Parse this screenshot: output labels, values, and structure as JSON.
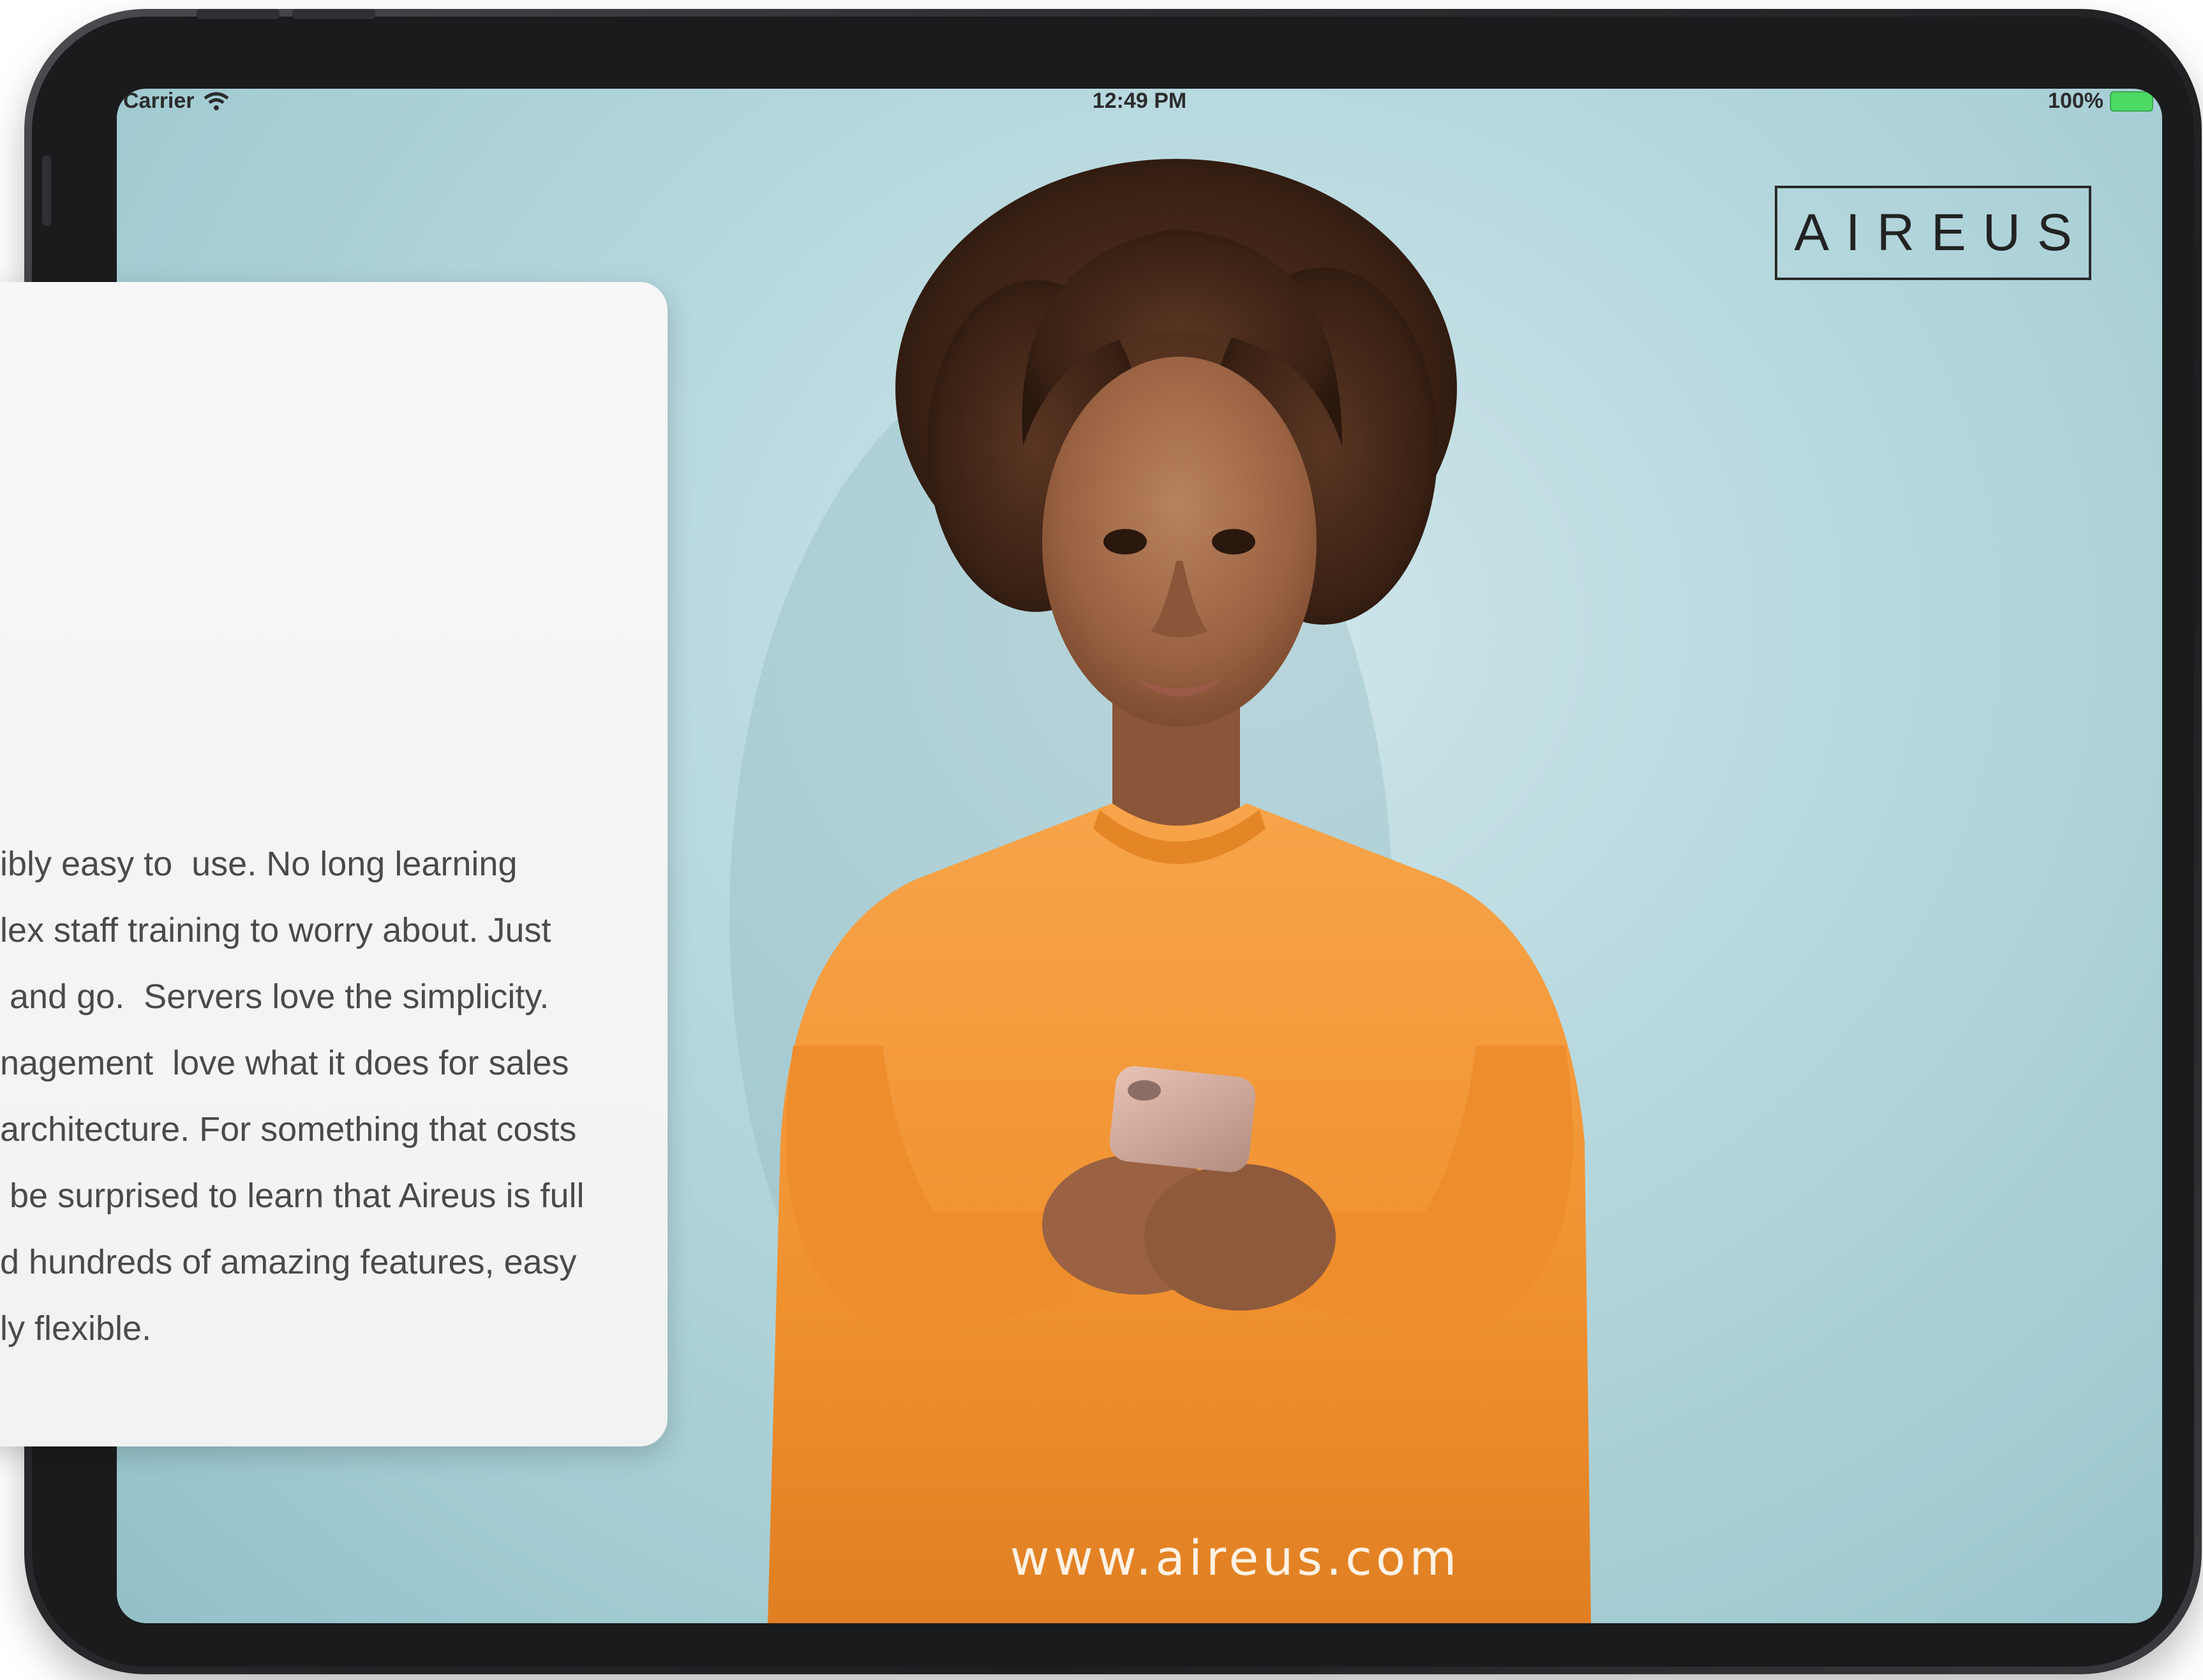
{
  "status_bar": {
    "carrier": "Carrier",
    "time": "12:49 PM",
    "battery": "100%",
    "icons": [
      "wifi-icon",
      "battery-icon"
    ]
  },
  "brand": {
    "logo": "AIREUS"
  },
  "card": {
    "lines": [
      "ibly easy to  use. No long learning",
      "lex staff training to worry about. Just",
      " and go.  Servers love the simplicity.",
      "nagement  love what it does for sales",
      "architecture. For something that costs",
      " be surprised to learn that Aireus is full",
      "d hundreds of amazing features, easy",
      "ly flexible."
    ]
  },
  "website": "www.aireus.com",
  "colors": {
    "background": "#b6d8de",
    "sweater": "#f39a3a",
    "card": "#f4f4f4"
  }
}
